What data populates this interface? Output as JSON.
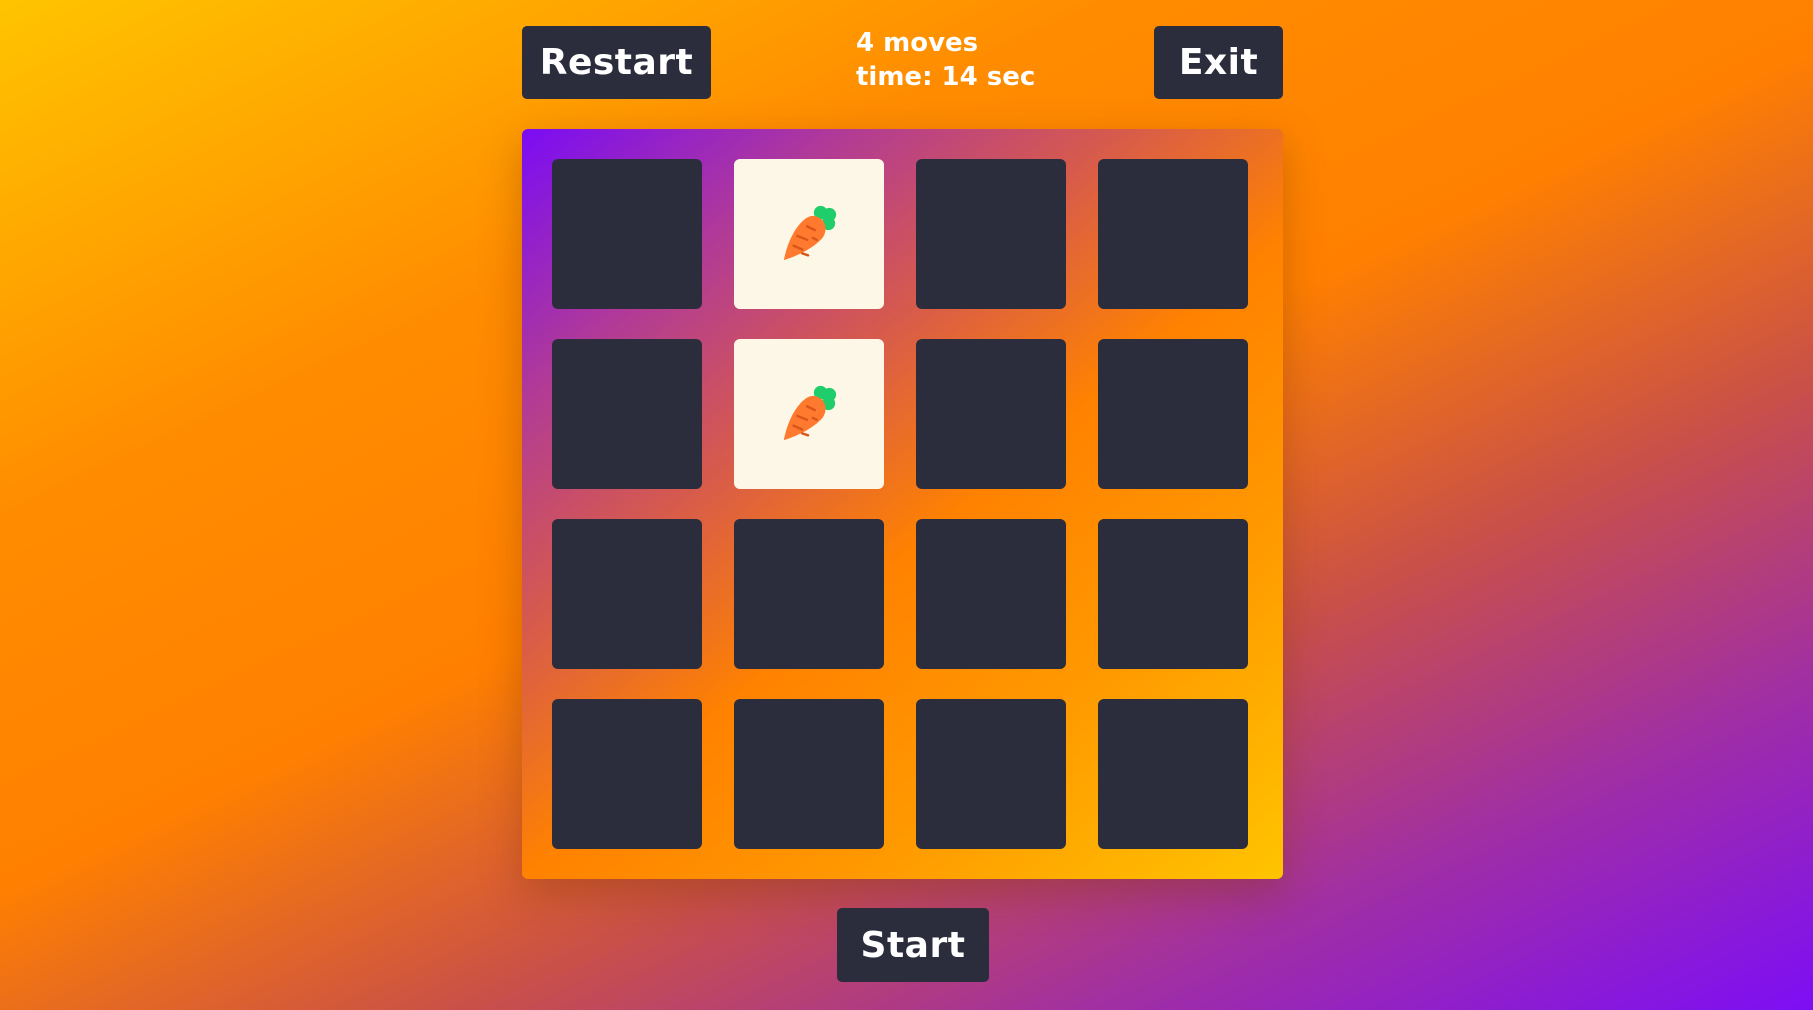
{
  "controls": {
    "restart_label": "Restart",
    "exit_label": "Exit",
    "start_label": "Start"
  },
  "stats": {
    "moves": "4 moves",
    "time": "time: 14 sec"
  },
  "colors": {
    "card_back": "#2b2d3c",
    "card_front": "#fdf7e7",
    "carrot_body": "#ff7a2f",
    "carrot_leaves": "#1fcd6b"
  },
  "board": {
    "rows": 4,
    "cols": 4,
    "cards": [
      {
        "row": 1,
        "col": 1,
        "face": "hidden"
      },
      {
        "row": 1,
        "col": 2,
        "face": "carrot-icon"
      },
      {
        "row": 1,
        "col": 3,
        "face": "hidden"
      },
      {
        "row": 1,
        "col": 4,
        "face": "hidden"
      },
      {
        "row": 2,
        "col": 1,
        "face": "hidden"
      },
      {
        "row": 2,
        "col": 2,
        "face": "carrot-icon"
      },
      {
        "row": 2,
        "col": 3,
        "face": "hidden"
      },
      {
        "row": 2,
        "col": 4,
        "face": "hidden"
      },
      {
        "row": 3,
        "col": 1,
        "face": "hidden"
      },
      {
        "row": 3,
        "col": 2,
        "face": "hidden"
      },
      {
        "row": 3,
        "col": 3,
        "face": "hidden"
      },
      {
        "row": 3,
        "col": 4,
        "face": "hidden"
      },
      {
        "row": 4,
        "col": 1,
        "face": "hidden"
      },
      {
        "row": 4,
        "col": 2,
        "face": "hidden"
      },
      {
        "row": 4,
        "col": 3,
        "face": "hidden"
      },
      {
        "row": 4,
        "col": 4,
        "face": "hidden"
      }
    ]
  }
}
